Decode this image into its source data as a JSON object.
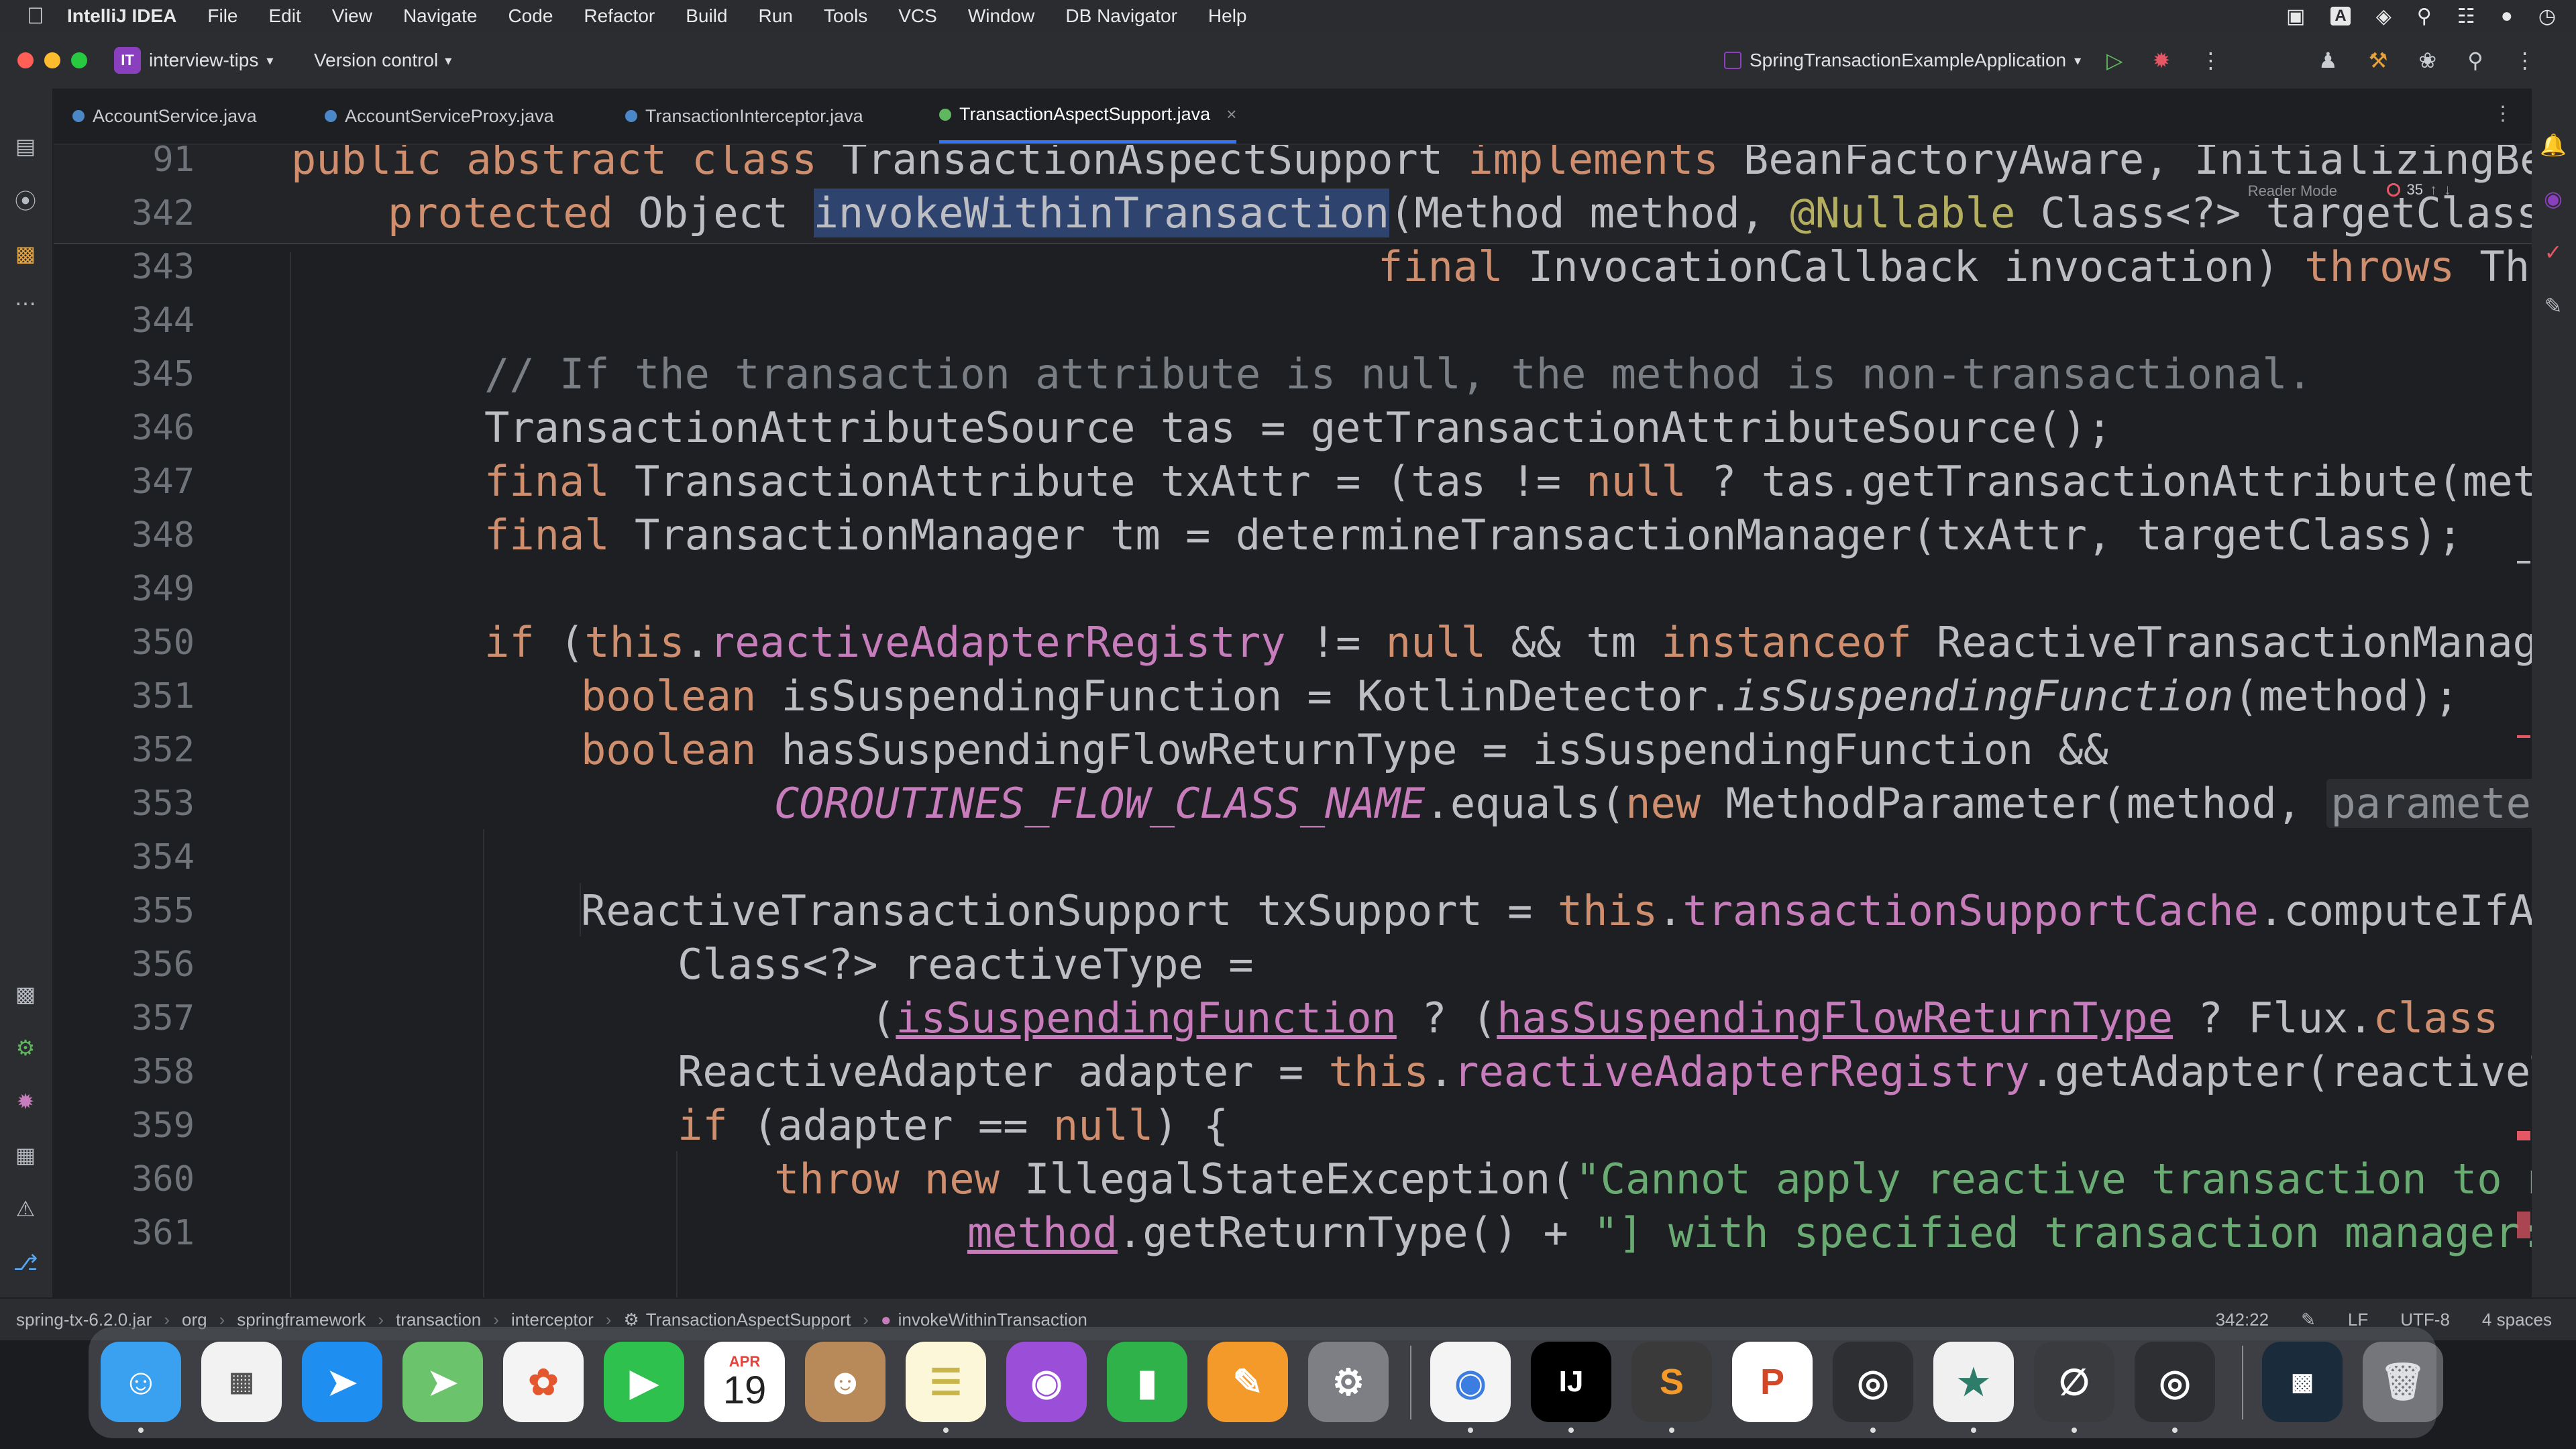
{
  "menubar": {
    "app_name": "IntelliJ IDEA",
    "items": [
      "File",
      "Edit",
      "View",
      "Navigate",
      "Code",
      "Refactor",
      "Build",
      "Run",
      "Tools",
      "VCS",
      "Window",
      "DB Navigator",
      "Help"
    ]
  },
  "titlebar": {
    "project_badge": "IT",
    "project_name": "interview-tips",
    "vcs_label": "Version control",
    "run_config": "SpringTransactionExampleApplication"
  },
  "tabs": [
    {
      "label": "AccountService.java",
      "active": false
    },
    {
      "label": "AccountServiceProxy.java",
      "active": false
    },
    {
      "label": "TransactionInterceptor.java",
      "active": false
    },
    {
      "label": "TransactionAspectSupport.java",
      "active": true
    }
  ],
  "editor": {
    "reader_mode": "Reader Mode",
    "problem_count": "35",
    "line_numbers": [
      "91",
      "342",
      "343",
      "344",
      "345",
      "346",
      "347",
      "348",
      "349",
      "350",
      "351",
      "352",
      "353",
      "354",
      "355",
      "356",
      "357",
      "358",
      "359",
      "360",
      "361"
    ],
    "code": {
      "l91_a": "public abstract class ",
      "l91_b": "TransactionAspectSupport ",
      "l91_c": "implements ",
      "l91_d": "BeanFactoryAware, InitializingBean",
      "l342_a": "protected ",
      "l342_b": "Object ",
      "l342_c": "invokeWithinTransaction",
      "l342_d": "(Method method, ",
      "l342_e": "@Nullable ",
      "l342_f": "Class<?> targetClass,",
      "l343_a": "final ",
      "l343_b": "InvocationCallback invocation) ",
      "l343_c": "throws ",
      "l343_d": "Throwable",
      "l345": "// If the transaction attribute is null, the method is non-transactional.",
      "l346": "TransactionAttributeSource tas = getTransactionAttributeSource();",
      "l347_a": "final ",
      "l347_b": "TransactionAttribute txAttr = (tas != ",
      "l347_c": "null ",
      "l347_d": "? tas.getTransactionAttribute(method",
      "l348_a": "final ",
      "l348_b": "TransactionManager tm = determineTransactionManager(txAttr, targetClass);",
      "l350_a": "if ",
      "l350_b": "(",
      "l350_c": "this",
      "l350_d": ".",
      "l350_e": "reactiveAdapterRegistry",
      "l350_f": " != ",
      "l350_g": "null ",
      "l350_h": "&& tm ",
      "l350_i": "instanceof ",
      "l350_j": "ReactiveTransactionManager",
      "l351_a": "boolean ",
      "l351_b": "isSuspendingFunction = KotlinDetector.",
      "l351_c": "isSuspendingFunction",
      "l351_d": "(method);",
      "l352_a": "boolean ",
      "l352_b": "hasSuspendingFlowReturnType = isSuspendingFunction &&",
      "l353_a": "COROUTINES_FLOW_CLASS_NAME",
      "l353_b": ".equals(",
      "l353_c": "new ",
      "l353_d": "MethodParameter(method, ",
      "l353_e": "parameterInd",
      "l355_a": "ReactiveTransactionSupport txSupport = ",
      "l355_b": "this",
      "l355_c": ".",
      "l355_d": "transactionSupportCache",
      "l355_e": ".computeIfAbse",
      "l356": "Class<?> reactiveType =",
      "l357_a": "(",
      "l357_b": "isSuspendingFunction",
      "l357_c": " ? (",
      "l357_d": "hasSuspendingFlowReturnType",
      "l357_e": " ? Flux.",
      "l357_f": "class",
      "l357_g": " :",
      "l358_a": "ReactiveAdapter adapter = ",
      "l358_b": "this",
      "l358_c": ".",
      "l358_d": "reactiveAdapterRegistry",
      "l358_e": ".getAdapter(reactiveTy",
      "l359_a": "if ",
      "l359_b": "(adapter == ",
      "l359_c": "null",
      "l359_d": ") {",
      "l360_a": "throw new ",
      "l360_b": "IllegalStateException(",
      "l360_c": "\"Cannot apply reactive transaction to no",
      "l361_a": "method",
      "l361_b": ".getReturnType() + ",
      "l361_c": "\"] with specified transaction manager: \""
    }
  },
  "breadcrumb": [
    "spring-tx-6.2.0.jar",
    "org",
    "springframework",
    "transaction",
    "interceptor",
    "TransactionAspectSupport",
    "invokeWithinTransaction"
  ],
  "status": {
    "position": "342:22",
    "line_sep": "LF",
    "encoding": "UTF-8",
    "indent": "4 spaces"
  },
  "dock": {
    "calendar_month": "APR",
    "calendar_day": "19",
    "intellij_label": "IJ",
    "apps": [
      "finder-icon",
      "launchpad-icon",
      "safari-icon",
      "maps-icon",
      "photos-icon",
      "facetime-icon",
      "calendar-icon",
      "contacts-icon",
      "notes-icon",
      "podcasts-icon",
      "numbers-icon",
      "pages-icon",
      "system-settings-icon",
      "chrome-icon",
      "intellij-icon",
      "sublime-icon",
      "powerpoint-icon",
      "screenshot-icon",
      "ce-icon",
      "null-icon",
      "screenshot2-icon",
      "screensaver-icon",
      "trash-icon"
    ]
  },
  "colors": {
    "keyword": "#cf8e6d",
    "comment": "#7a7e85",
    "field": "#c77dbb",
    "string": "#6aab73",
    "annotation": "#b3ae60",
    "accent": "#3574f0"
  }
}
